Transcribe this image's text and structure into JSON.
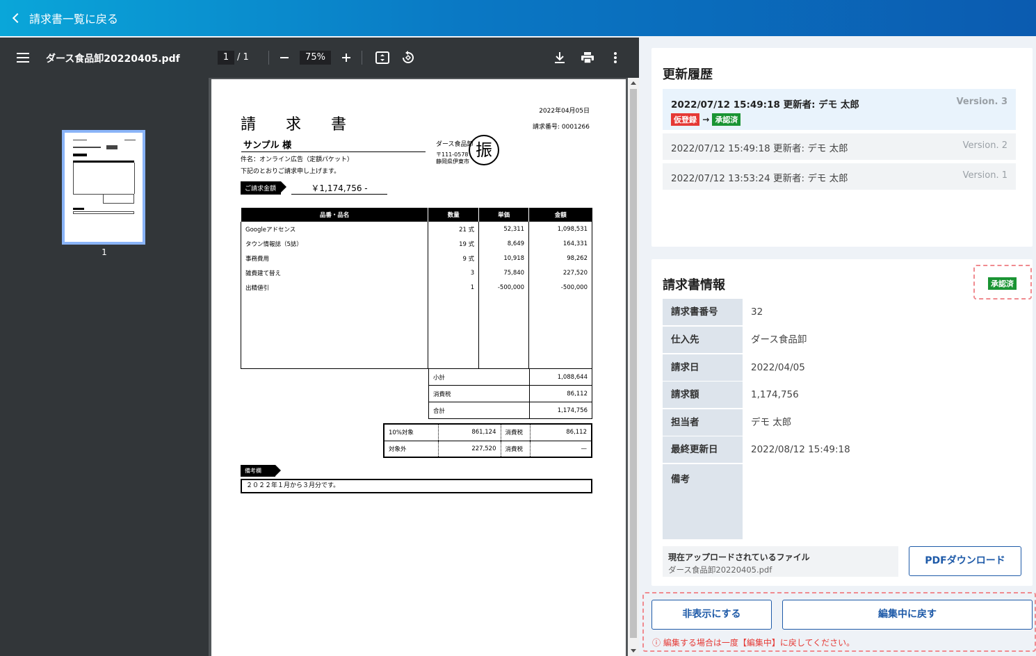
{
  "topbar": {
    "back_label": "請求書一覧に戻る"
  },
  "viewer": {
    "filename": "ダース食品卸20220405.pdf",
    "page_current": "1",
    "page_total": "/ 1",
    "zoom": "75%",
    "thumb_label": "1"
  },
  "invoice": {
    "title": "請 求 書",
    "date": "2022年04月05日",
    "number": "請求番号: 0001266",
    "customer": "サンプル 様",
    "subject": "件名：オンライン広告（定額パケット）",
    "note": "下記のとおりご請求申し上げます。",
    "vendor": "ダース食品卸",
    "vendor_zip": "〒111-0578",
    "vendor_addr": "静岡県伊東市",
    "stamp": "振",
    "total_tag": "ご請求金額",
    "total_amount": "￥1,174,756 -",
    "headers": [
      "品番・品名",
      "数量",
      "単価",
      "金額"
    ],
    "items": [
      {
        "name": "Googleアドセンス",
        "qty": "21 式",
        "price": "52,311",
        "amount": "1,098,531"
      },
      {
        "name": "タウン情報誌（5誌）",
        "qty": "19 式",
        "price": "8,649",
        "amount": "164,331"
      },
      {
        "name": "事務費用",
        "qty": "9 式",
        "price": "10,918",
        "amount": "98,262"
      },
      {
        "name": "雑費建て替え",
        "qty": "3",
        "price": "75,840",
        "amount": "227,520"
      },
      {
        "name": "出精値引",
        "qty": "1",
        "price": "-500,000",
        "amount": "-500,000"
      }
    ],
    "totals": [
      {
        "label": "小計",
        "value": "1,088,644"
      },
      {
        "label": "消費税",
        "value": "86,112"
      },
      {
        "label": "合計",
        "value": "1,174,756"
      }
    ],
    "tax": [
      {
        "label": "10%対象",
        "base": "861,124",
        "tlabel": "消費税",
        "tax": "86,112"
      },
      {
        "label": "対象外",
        "base": "227,520",
        "tlabel": "消費税",
        "tax": "—"
      }
    ],
    "remark_tag": "備考欄",
    "remark": "２０２２年１月から３月分です。"
  },
  "history": {
    "title": "更新履歴",
    "rows": [
      {
        "text": "2022/07/12  15:49:18  更新者: デモ 太郎",
        "version": "Version. 3",
        "from": "仮登録",
        "arrow": "→",
        "to": "承認済"
      },
      {
        "text": "2022/07/12  15:49:18  更新者: デモ 太郎",
        "version": "Version. 2"
      },
      {
        "text": "2022/07/12  13:53:24  更新者: デモ 太郎",
        "version": "Version. 1"
      }
    ]
  },
  "info": {
    "title": "請求書情報",
    "status": "承認済",
    "fields": [
      {
        "key": "請求書番号",
        "value": "32"
      },
      {
        "key": "仕入先",
        "value": "ダース食品卸"
      },
      {
        "key": "請求日",
        "value": "2022/04/05"
      },
      {
        "key": "請求額",
        "value": "1,174,756"
      },
      {
        "key": "担当者",
        "value": "デモ 太郎"
      },
      {
        "key": "最終更新日",
        "value": "2022/08/12 15:49:18"
      },
      {
        "key": "備考",
        "value": ""
      }
    ],
    "file_title": "現在アップロードされているファイル",
    "file_name": "ダース食品卸20220405.pdf",
    "pdf_button": "PDFダウンロード"
  },
  "actions": {
    "hide_button": "非表示にする",
    "back_to_edit_button": "編集中に戻す",
    "warning": "ⓘ 編集する場合は一度【編集中】に戻してください。"
  },
  "colors": {
    "accent": "#1e5aa8",
    "topbar": "#0a78c4",
    "approved": "#1a9433",
    "draft": "#e53935"
  }
}
